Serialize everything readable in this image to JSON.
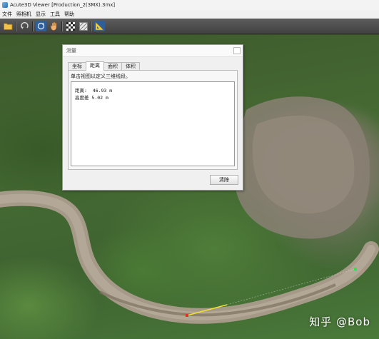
{
  "window": {
    "title": "Acute3D Viewer [Production_2(3MX).3mx]"
  },
  "menu": {
    "items": [
      "文件",
      "照相机",
      "显示",
      "工具",
      "帮助"
    ]
  },
  "toolbar": {
    "buttons": [
      {
        "icon": "open-folder-icon"
      },
      {
        "icon": "reset-view-icon"
      },
      {
        "icon": "rotate-icon"
      },
      {
        "icon": "pan-hand-icon"
      },
      {
        "icon": "checker-texture-icon"
      },
      {
        "icon": "wireframe-icon"
      },
      {
        "icon": "measure-ruler-icon"
      }
    ]
  },
  "dialog": {
    "title": "测量",
    "tabs": [
      "坐标",
      "距离",
      "面积",
      "体积"
    ],
    "active_tab_index": 1,
    "description": "单击视图以定义三维线段。",
    "results": [
      {
        "label": "距离:",
        "value": "46.93",
        "unit": "m"
      },
      {
        "label": "高度差",
        "value": "5.02",
        "unit": "m"
      }
    ],
    "clear_label": "清除"
  },
  "watermark": "知乎 @Bob",
  "colors": {
    "toolbar_bg": "#4f4f4f",
    "measure_line": "#f0e030",
    "start_marker": "#e03020",
    "end_marker": "#30e050"
  }
}
